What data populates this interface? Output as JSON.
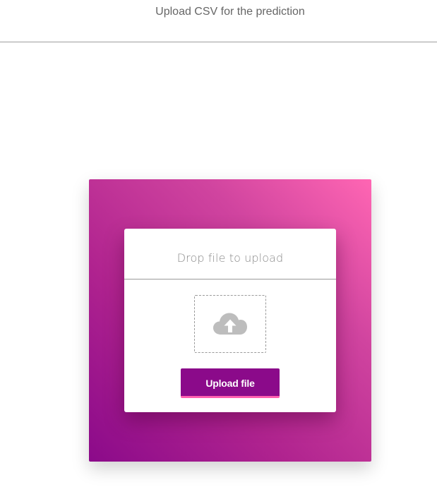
{
  "header": {
    "title": "Upload CSV for the prediction"
  },
  "upload_panel": {
    "heading": "Drop file to upload",
    "drop_zone_icon": "cloud-upload-icon",
    "upload_button_label": "Upload file"
  },
  "colors": {
    "gradient_start": "#8b0a8a",
    "gradient_end": "#ff66b3",
    "button_background": "#8b0a8a",
    "button_accent": "#ff5fb0",
    "icon_gray": "#bdbdbd"
  }
}
